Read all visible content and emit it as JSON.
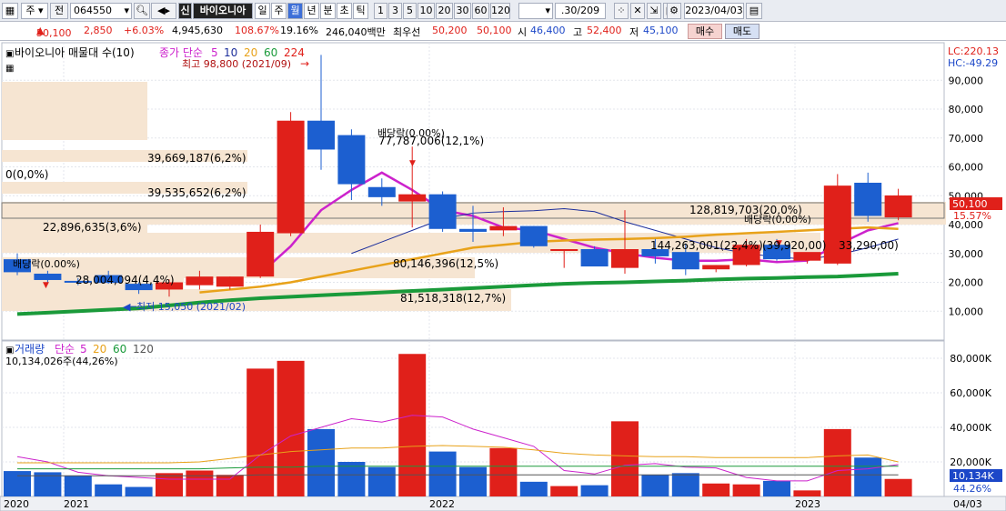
{
  "toolbar": {
    "market": "주",
    "prev": "전",
    "code": "064550",
    "new_badge": "신",
    "stock_name": "바이오니아",
    "periods": [
      "일",
      "주",
      "월",
      "년",
      "분",
      "초",
      "틱"
    ],
    "active_period": "월",
    "numbers": [
      "1",
      "3",
      "5",
      "10",
      "20",
      "30",
      "60",
      "120"
    ],
    "count": ".30/209",
    "date": "2023/04/03"
  },
  "info": {
    "price": "50,100",
    "change": "2,850",
    "change_pct": "+6.03%",
    "volume": "4,945,630",
    "ratio": "108.67%",
    "turnover": "19.16%",
    "amount": "246,040백만",
    "best_label": "최우선",
    "ask": "50,200",
    "bid": "50,100",
    "open_label": "시",
    "open": "46,400",
    "high_label": "고",
    "high": "52,400",
    "low_label": "저",
    "low": "45,100",
    "buy": "매수",
    "sell": "매도"
  },
  "price_panel": {
    "title": "바이오니아 매물대 수(10)",
    "ma_label": "종가 단순",
    "ma_periods": [
      "5",
      "10",
      "20",
      "60",
      "224"
    ],
    "ma_colors": [
      "#cc22cc",
      "#1c2e9c",
      "#e8a21a",
      "#1a9a3a",
      "#e0201a"
    ],
    "lc": "LC:220.13",
    "hc": "HC:-49.29",
    "high_note": "최고 98,800 (2021/09)",
    "low_note": "최저 15,050 (2021/02)",
    "dividend_label": "배당락(0.00%)",
    "dividend_label2": "배당락(0,00%)",
    "current_tag": "50,100",
    "current_pct": "15.57%",
    "y_ticks": [
      "90,000",
      "80,000",
      "70,000",
      "60,000",
      "50,000",
      "40,000",
      "30,000",
      "20,000",
      "10,000"
    ],
    "profile_labels": [
      "0(0,0%)",
      "39,669,187(6,2%)",
      "77,787,006(12,1%)",
      "39,535,652(6,2%)",
      "128,819,703(20,0%)",
      "22,896,635(3,6%)",
      "144,263,001(22,4%)",
      "80,146,396(12,5%)",
      "28,004,094(4,4%)",
      "81,518,318(12,7%)",
      "(39,920,00)",
      "33,290,00)"
    ]
  },
  "volume_panel": {
    "title": "거래량",
    "ma_label": "단순",
    "ma_periods": [
      "5",
      "20",
      "60",
      "120"
    ],
    "current_volume": "10,134,026주(44,26%)",
    "current_tag": "10,134K",
    "current_pct": "44.26%",
    "y_ticks": [
      "80,000K",
      "60,000K",
      "40,000K",
      "20,000K"
    ]
  },
  "x_axis": {
    "labels": [
      "2020",
      "2021",
      "2022",
      "2023",
      "04/03"
    ]
  },
  "chart_data": {
    "type": "candlestick",
    "unit": "KRW",
    "candles": [
      {
        "o": 28000,
        "h": 30000,
        "l": 22500,
        "c": 23500
      },
      {
        "o": 23000,
        "h": 24000,
        "l": 20000,
        "c": 20800
      },
      {
        "o": 20500,
        "h": 21500,
        "l": 19000,
        "c": 20000
      },
      {
        "o": 22500,
        "h": 24000,
        "l": 19500,
        "c": 19800
      },
      {
        "o": 19500,
        "h": 20000,
        "l": 16000,
        "c": 17300
      },
      {
        "o": 17500,
        "h": 21000,
        "l": 15050,
        "c": 20000
      },
      {
        "o": 19000,
        "h": 24000,
        "l": 17500,
        "c": 22000
      },
      {
        "o": 18500,
        "h": 22000,
        "l": 17500,
        "c": 22000
      },
      {
        "o": 22000,
        "h": 40000,
        "l": 21500,
        "c": 37500
      },
      {
        "o": 37000,
        "h": 79000,
        "l": 36000,
        "c": 76000
      },
      {
        "o": 76000,
        "h": 98800,
        "l": 59000,
        "c": 66000
      },
      {
        "o": 71000,
        "h": 73000,
        "l": 48500,
        "c": 54000
      },
      {
        "o": 53000,
        "h": 56000,
        "l": 46500,
        "c": 49500
      },
      {
        "o": 48000,
        "h": 67000,
        "l": 39000,
        "c": 50500
      },
      {
        "o": 50500,
        "h": 51500,
        "l": 37500,
        "c": 38500
      },
      {
        "o": 38500,
        "h": 46500,
        "l": 34000,
        "c": 37500
      },
      {
        "o": 38000,
        "h": 46000,
        "l": 36000,
        "c": 39500
      },
      {
        "o": 39500,
        "h": 39500,
        "l": 32000,
        "c": 32500
      },
      {
        "o": 31000,
        "h": 31500,
        "l": 25000,
        "c": 31500
      },
      {
        "o": 31500,
        "h": 32500,
        "l": 26000,
        "c": 25500
      },
      {
        "o": 25000,
        "h": 45000,
        "l": 23000,
        "c": 31500
      },
      {
        "o": 31500,
        "h": 35000,
        "l": 26500,
        "c": 29000
      },
      {
        "o": 30500,
        "h": 33500,
        "l": 22500,
        "c": 24500
      },
      {
        "o": 24500,
        "h": 26000,
        "l": 23500,
        "c": 26000
      },
      {
        "o": 26000,
        "h": 35000,
        "l": 25500,
        "c": 33000
      },
      {
        "o": 33000,
        "h": 35000,
        "l": 27500,
        "c": 28000
      },
      {
        "o": 27500,
        "h": 30000,
        "l": 26500,
        "c": 30500
      },
      {
        "o": 26500,
        "h": 57500,
        "l": 26000,
        "c": 53500
      },
      {
        "o": 54500,
        "h": 58000,
        "l": 41000,
        "c": 43000
      },
      {
        "o": 42500,
        "h": 52400,
        "l": 41500,
        "c": 50100
      }
    ],
    "volume_k": [
      14700,
      14000,
      12000,
      7000,
      5500,
      13500,
      15000,
      12500,
      74000,
      78500,
      39000,
      20000,
      17000,
      82500,
      26000,
      17000,
      28000,
      8500,
      6000,
      6500,
      43500,
      12500,
      13500,
      7500,
      7000,
      9000,
      3500,
      39000,
      22500,
      10134
    ],
    "ma": {
      "5": [
        null,
        null,
        null,
        null,
        null,
        null,
        null,
        null,
        23000,
        32500,
        45000,
        52000,
        58000,
        52000,
        45000,
        43000,
        39000,
        38000,
        35000,
        32000,
        30000,
        28500,
        27500,
        27500,
        28000,
        27000,
        27500,
        33000,
        38000,
        40500
      ],
      "10": [
        null,
        null,
        null,
        null,
        null,
        null,
        null,
        null,
        null,
        null,
        null,
        30000,
        34000,
        38000,
        42000,
        44000,
        44500,
        44800,
        45500,
        44500,
        41000,
        38000,
        35000,
        32000,
        30000,
        28800,
        28000,
        29500,
        32000,
        35000
      ],
      "20": [
        null,
        null,
        null,
        null,
        null,
        null,
        16500,
        17500,
        18500,
        20000,
        22000,
        24000,
        26000,
        28000,
        30000,
        32000,
        33000,
        34000,
        34500,
        34800,
        35000,
        35300,
        35800,
        36500,
        37000,
        37500,
        38000,
        38500,
        39000,
        38500
      ],
      "60": [
        9000,
        9500,
        10000,
        10500,
        11000,
        12000,
        13000,
        13800,
        14500,
        15000,
        15500,
        16000,
        16500,
        17000,
        17500,
        18000,
        18500,
        19000,
        19500,
        19800,
        20000,
        20300,
        20600,
        21000,
        21300,
        21500,
        21800,
        22000,
        22500,
        23000
      ]
    },
    "volume_ma_k": {
      "5": [
        23000,
        20000,
        14000,
        12000,
        11000,
        10000,
        10000,
        10000,
        24000,
        35000,
        40000,
        45000,
        43000,
        47000,
        46000,
        39000,
        34000,
        29000,
        15000,
        13000,
        18000,
        19000,
        17000,
        16500,
        11000,
        9000,
        9000,
        15000,
        16000,
        18500
      ],
      "20": [
        19500,
        19500,
        19500,
        19500,
        19500,
        19500,
        20000,
        22000,
        24000,
        26000,
        27000,
        28000,
        28000,
        29000,
        29500,
        29000,
        28500,
        27000,
        25000,
        24000,
        23500,
        23000,
        23000,
        22500,
        22500,
        22500,
        22500,
        23500,
        24000,
        20000
      ],
      "60": [
        16000,
        16000,
        16000,
        16000,
        16000,
        16000,
        16000,
        16500,
        17000,
        17000,
        17500,
        17500,
        17500,
        17500,
        17500,
        17500,
        17500,
        17500,
        17500,
        17500,
        17500,
        17500,
        17500,
        17500,
        17500,
        17500,
        17500,
        17500,
        17500,
        17500
      ],
      "120": [
        12000,
        12000,
        12000,
        12000,
        12000,
        12000,
        12000,
        12000,
        12500,
        12500,
        12500,
        12500,
        12500,
        12500,
        12500,
        12500,
        12500,
        12500,
        12500,
        12500,
        12500,
        12500,
        12500,
        12500,
        12500,
        12500,
        12500,
        12500,
        12500,
        12500
      ]
    },
    "ylim": [
      0,
      103000
    ],
    "volume_ylim_k": [
      0,
      90000
    ]
  }
}
